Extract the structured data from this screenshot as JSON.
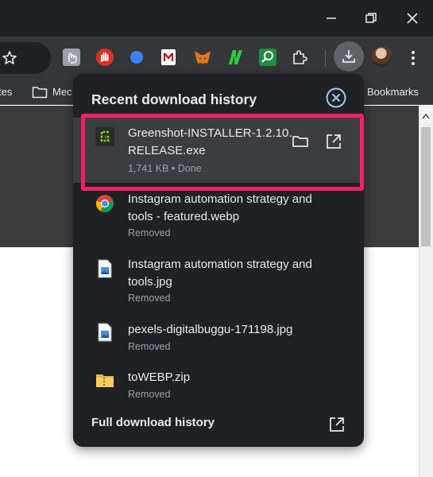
{
  "window": {
    "minimize_icon": "minimize-icon",
    "restore_icon": "restore-icon",
    "close_icon": "close-icon"
  },
  "toolbar": {
    "bookmark_star_icon": "star-icon",
    "extensions": [
      "hand-extension-icon",
      "stop-hand-extension-icon",
      "blue-dot-extension-icon",
      "mcafee-extension-icon",
      "metamask-extension-icon",
      "n-extension-icon",
      "search-extension-icon",
      "puzzle-extensions-icon"
    ],
    "download_icon": "download-icon",
    "menu_icon": "more-vert-icon"
  },
  "bookmarks_bar": {
    "left_fragment": "tes",
    "folder_fragment": "Mec",
    "right_fragment": "Bookmarks"
  },
  "downloads": {
    "title": "Recent download history",
    "items": [
      {
        "name": "Greenshot-INSTALLER-1.2.10.RELEASE.exe",
        "name_line1": "Greenshot-INSTALLER-1.2.10.",
        "name_line2": "RELEASE.exe",
        "status": "1,741 KB • Done",
        "icon": "greenshot-icon",
        "highlighted": true
      },
      {
        "name": "Instagram automation strategy and tools - featured.webp",
        "name_line1": "Instagram automation strategy and",
        "name_line2": "tools - featured.webp",
        "status": "Removed",
        "icon": "chrome-icon"
      },
      {
        "name": "Instagram automation strategy and tools.jpg",
        "name_line1": "Instagram automation strategy and",
        "name_line2": "tools.jpg",
        "status": "Removed",
        "icon": "image-file-icon"
      },
      {
        "name": "pexels-digitalbuggu-171198.jpg",
        "name_line1": "pexels-digitalbuggu-171198.jpg",
        "status": "Removed",
        "icon": "image-file-icon"
      },
      {
        "name": "toWEBP.zip",
        "name_line1": "toWEBP.zip",
        "status": "Removed",
        "icon": "zip-folder-icon"
      }
    ],
    "footer_label": "Full download history"
  },
  "colors": {
    "panel_bg": "#202124",
    "highlight_border": "#f0206a",
    "active_row_bg": "#3c3d41",
    "text_primary": "#e8eaed",
    "text_secondary": "#9aa0a6"
  }
}
